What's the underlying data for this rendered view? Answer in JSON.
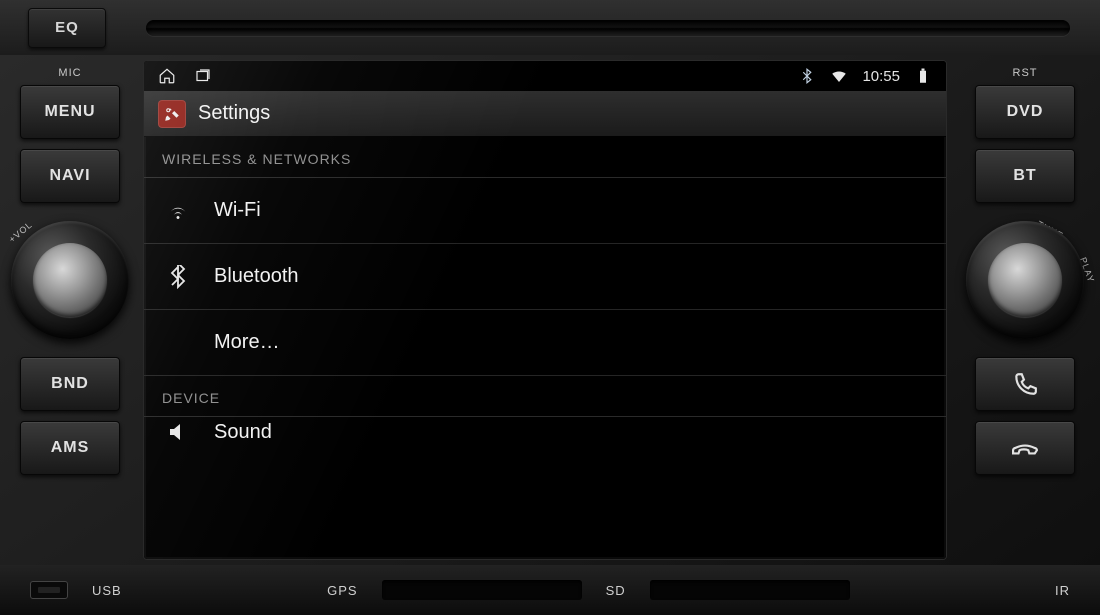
{
  "hardware": {
    "eq": "EQ",
    "mic_label": "MIC",
    "rst_label": "RST",
    "left_buttons": [
      "MENU",
      "NAVI",
      "BND",
      "AMS"
    ],
    "right_buttons": [
      "DVD",
      "BT"
    ],
    "left_knob": {
      "vol": "+VOL"
    },
    "right_knob": {
      "tune": "TUNE",
      "play": "PLAY"
    },
    "bottom": {
      "usb": "USB",
      "gps": "GPS",
      "sd": "SD",
      "ir": "IR"
    }
  },
  "statusbar": {
    "time": "10:55"
  },
  "settings": {
    "title": "Settings",
    "sections": [
      {
        "header": "WIRELESS & NETWORKS",
        "items": [
          {
            "key": "wifi",
            "label": "Wi-Fi"
          },
          {
            "key": "bluetooth",
            "label": "Bluetooth"
          },
          {
            "key": "more",
            "label": "More…"
          }
        ]
      },
      {
        "header": "DEVICE",
        "items": [
          {
            "key": "sound",
            "label": "Sound"
          }
        ]
      }
    ]
  }
}
